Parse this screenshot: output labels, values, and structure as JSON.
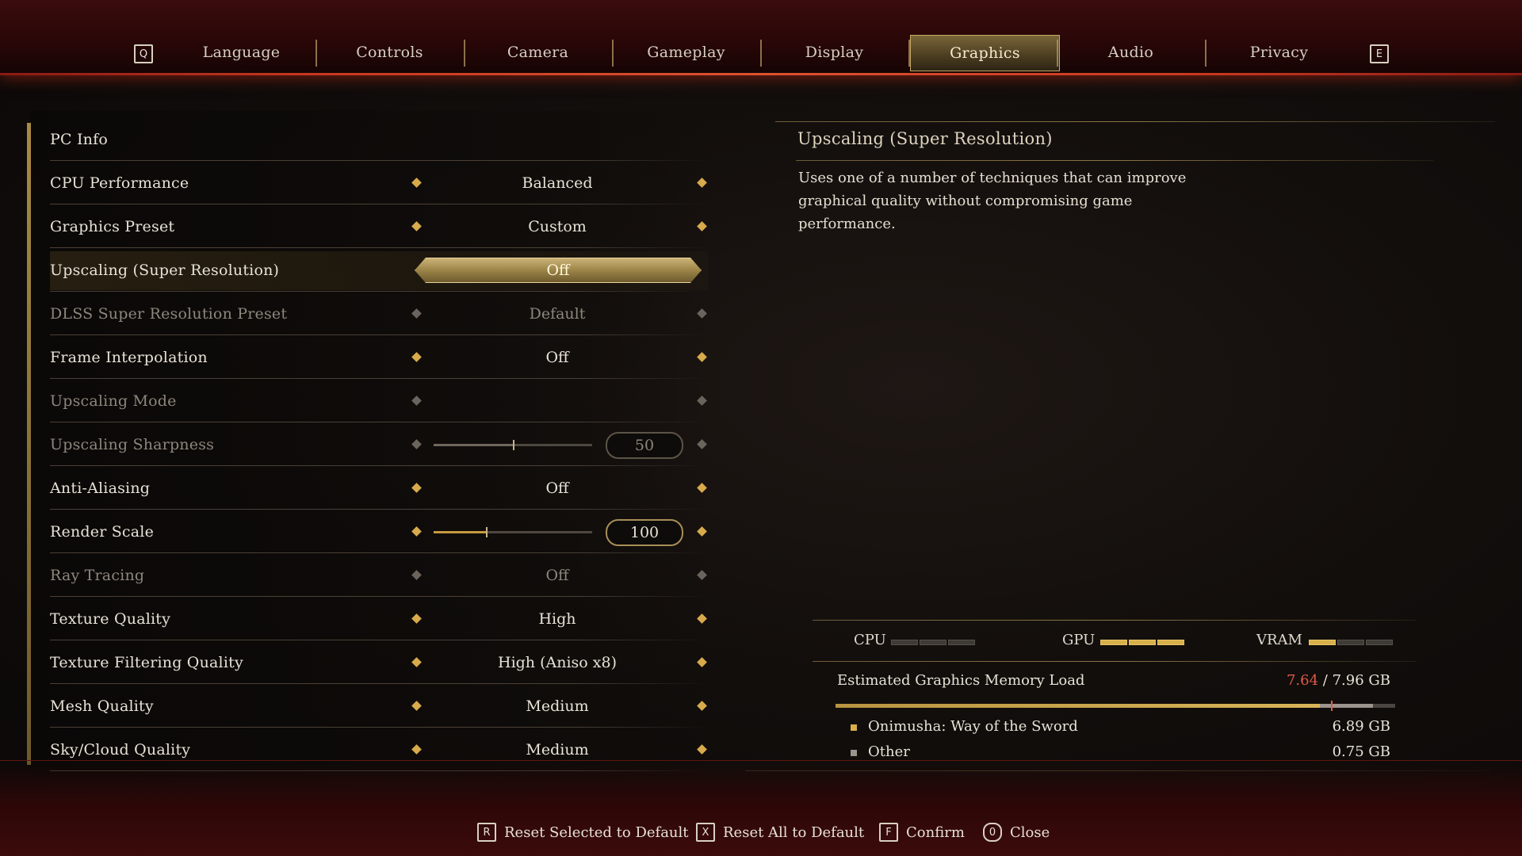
{
  "tabs": {
    "prev_key": "Q",
    "next_key": "E",
    "items": [
      {
        "label": "Language"
      },
      {
        "label": "Controls"
      },
      {
        "label": "Camera"
      },
      {
        "label": "Gameplay"
      },
      {
        "label": "Display"
      },
      {
        "label": "Graphics",
        "active": true
      },
      {
        "label": "Audio"
      },
      {
        "label": "Privacy"
      }
    ]
  },
  "settings": {
    "pc_info": "PC Info",
    "rows": [
      {
        "label": "CPU Performance",
        "value": "Balanced"
      },
      {
        "label": "Graphics Preset",
        "value": "Custom"
      },
      {
        "label": "Upscaling (Super Resolution)",
        "value": "Off",
        "selected": true
      },
      {
        "label": "DLSS Super Resolution Preset",
        "value": "Default",
        "disabled": true
      },
      {
        "label": "Frame Interpolation",
        "value": "Off"
      },
      {
        "label": "Upscaling Mode",
        "value": "",
        "disabled": true
      },
      {
        "label": "Upscaling Sharpness",
        "value": "50",
        "disabled": true,
        "slider_fraction": 0.5
      },
      {
        "label": "Anti-Aliasing",
        "value": "Off"
      },
      {
        "label": "Render Scale",
        "value": "100",
        "slider_fraction": 0.33
      },
      {
        "label": "Ray Tracing",
        "value": "Off",
        "disabled": true
      },
      {
        "label": "Texture Quality",
        "value": "High"
      },
      {
        "label": "Texture Filtering Quality",
        "value": "High (Aniso x8)"
      },
      {
        "label": "Mesh Quality",
        "value": "Medium"
      },
      {
        "label": "Sky/Cloud Quality",
        "value": "Medium"
      }
    ]
  },
  "description": {
    "title": "Upscaling (Super Resolution)",
    "text": "Uses one of a number of techniques that can improve graphical quality without compromising game performance."
  },
  "load": {
    "cpu_label": "CPU",
    "gpu_label": "GPU",
    "vram_label": "VRAM",
    "cpu_level": 0,
    "gpu_level": 3,
    "vram_level": 1,
    "segments": 3
  },
  "memory": {
    "title": "Estimated Graphics Memory Load",
    "used": "7.64",
    "total": "/ 7.96 GB",
    "game_fraction": 0.866,
    "other_fraction": 0.094,
    "items": [
      {
        "label": "Onimusha: Way of the Sword",
        "amount": "6.89 GB",
        "color": "#d8b04a"
      },
      {
        "label": "Other",
        "amount": "0.75 GB",
        "color": "#9a948c"
      }
    ]
  },
  "hints": [
    {
      "key": "R",
      "label": "Reset Selected to Default"
    },
    {
      "key": "X",
      "label": "Reset All to Default"
    },
    {
      "key": "F",
      "label": "Confirm"
    },
    {
      "key": "0",
      "label": "Close"
    }
  ]
}
